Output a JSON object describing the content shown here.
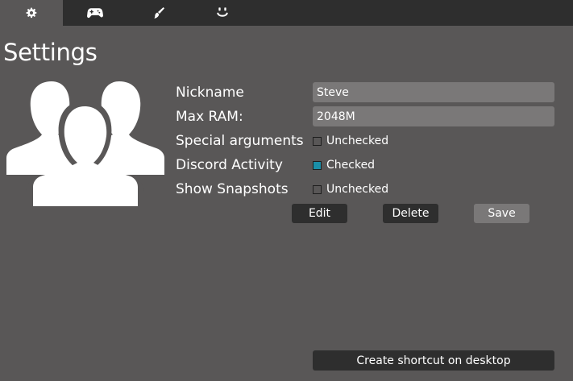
{
  "tabs": [
    {
      "icon": "gear-icon",
      "active": true
    },
    {
      "icon": "gamepad-icon",
      "active": false
    },
    {
      "icon": "brush-icon",
      "active": false
    },
    {
      "icon": "smiley-icon",
      "active": false
    }
  ],
  "page": {
    "title": "Settings"
  },
  "avatar": {
    "icon": "users-group-icon"
  },
  "form": {
    "nickname": {
      "label": "Nickname",
      "value": "Steve"
    },
    "max_ram": {
      "label": "Max RAM:",
      "value": "2048M"
    },
    "special_arguments": {
      "label": "Special arguments",
      "state": "Unchecked",
      "checked": false
    },
    "discord_activity": {
      "label": "Discord Activity",
      "state": "Checked",
      "checked": true
    },
    "show_snapshots": {
      "label": "Show Snapshots",
      "state": "Unchecked",
      "checked": false
    }
  },
  "actions": {
    "edit": "Edit",
    "delete": "Delete",
    "save": "Save"
  },
  "shortcut": {
    "label": "Create shortcut on desktop"
  },
  "colors": {
    "background": "#595757",
    "tabbar": "#2e2e2e",
    "input": "#7a7878",
    "checked": "#1a8fa8"
  }
}
